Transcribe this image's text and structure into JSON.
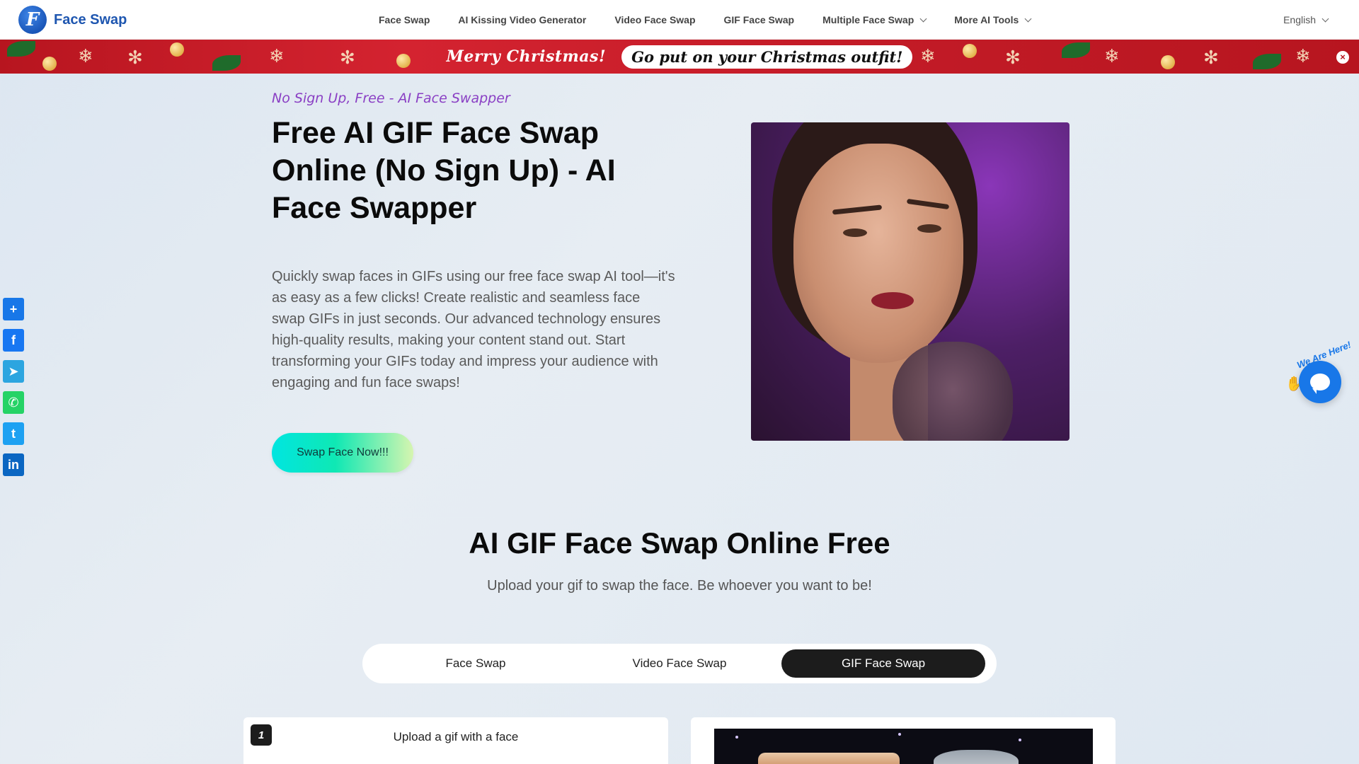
{
  "header": {
    "logo_letter": "F",
    "logo_text": "Face Swap",
    "nav": [
      {
        "label": "Face Swap"
      },
      {
        "label": "AI Kissing Video Generator"
      },
      {
        "label": "Video Face Swap"
      },
      {
        "label": "GIF Face Swap"
      },
      {
        "label": "Multiple Face Swap",
        "dropdown": true
      },
      {
        "label": "More AI Tools",
        "dropdown": true
      }
    ],
    "language": "English"
  },
  "banner": {
    "text1": "Merry Christmas!",
    "text2": "Go put on your Christmas outfit!",
    "close": "×"
  },
  "social": [
    {
      "icon": "share-plus-icon",
      "color": "#1877e8",
      "glyph": "+"
    },
    {
      "icon": "facebook-icon",
      "color": "#1877f2",
      "glyph": "f"
    },
    {
      "icon": "telegram-icon",
      "color": "#2ca5e0",
      "glyph": "➤"
    },
    {
      "icon": "whatsapp-icon",
      "color": "#25d366",
      "glyph": "✆"
    },
    {
      "icon": "twitter-icon",
      "color": "#1da1f2",
      "glyph": "t"
    },
    {
      "icon": "linkedin-icon",
      "color": "#0a66c2",
      "glyph": "in"
    }
  ],
  "hero": {
    "tagline": "No Sign Up, Free - AI Face Swapper",
    "title": "Free AI GIF Face Swap Online (No Sign Up) - AI Face Swapper",
    "description": "Quickly swap faces in GIFs using our free face swap AI tool—it's as easy as a few clicks! Create realistic and seamless face swap GIFs in just seconds. Our advanced technology ensures high-quality results, making your content stand out. Start transforming your GIFs today and impress your audience with engaging and fun face swaps!",
    "cta": "Swap Face Now!!!"
  },
  "tool": {
    "title": "AI GIF Face Swap Online Free",
    "subtitle": "Upload your gif to swap the face. Be whoever you want to be!",
    "tabs": [
      {
        "label": "Face Swap",
        "active": false
      },
      {
        "label": "Video Face Swap",
        "active": false
      },
      {
        "label": "GIF Face Swap",
        "active": true
      }
    ],
    "step1_number": "1",
    "step1_label": "Upload a gif with a face"
  },
  "chat": {
    "tag": "We Are Here!"
  },
  "colors": {
    "brand_blue": "#1e56b0",
    "tagline_purple": "#8a3fc4",
    "banner_red": "#c41c28",
    "cta_start": "#00e5e0",
    "cta_end": "#d6f5b0",
    "chat_blue": "#1877e8"
  }
}
